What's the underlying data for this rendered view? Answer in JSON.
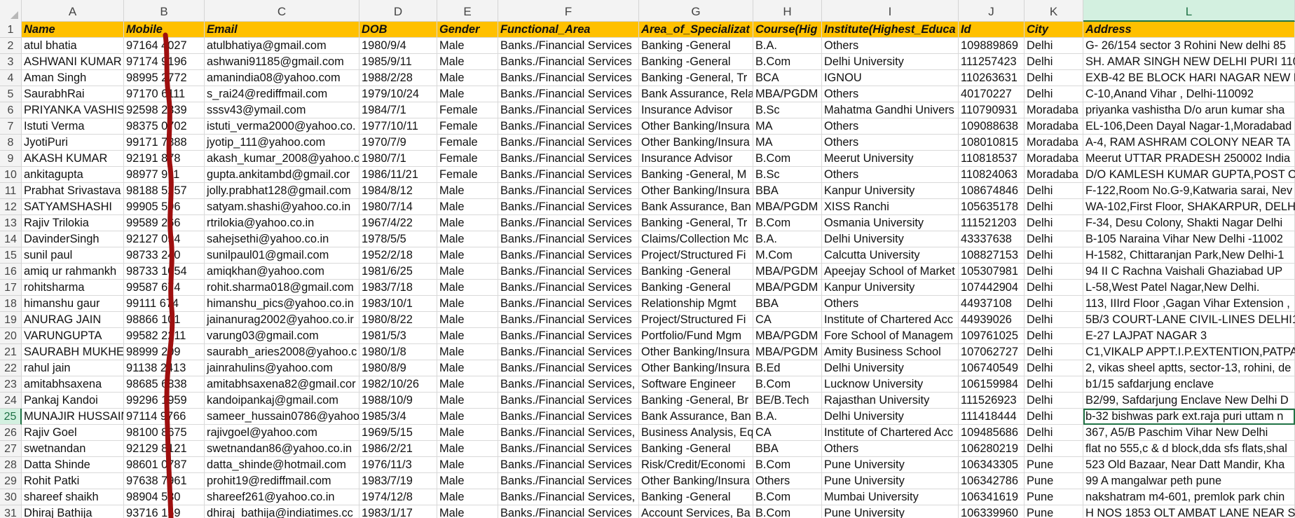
{
  "columns": [
    "A",
    "B",
    "C",
    "D",
    "E",
    "F",
    "G",
    "H",
    "I",
    "J",
    "K",
    "L"
  ],
  "selected_column": "L",
  "selected_row": "25",
  "header": [
    "Name",
    "Mobile",
    "Email",
    "DOB",
    "Gender",
    "Functional_Area",
    "Area_of_Specializat",
    "Course(Hig",
    "Institute(Highest_Educa",
    "Id",
    "City",
    "Address"
  ],
  "rows": [
    {
      "num": "2",
      "cells": [
        "atul bhatia",
        "97164 4027",
        "atulbhatiya@gmail.com",
        "1980/9/4",
        "Male",
        "Banks./Financial Services",
        "Banking -General",
        "B.A.",
        "Others",
        "109889869",
        "Delhi",
        "G- 26/154 sector 3 Rohini New delhi 85"
      ]
    },
    {
      "num": "3",
      "cells": [
        "ASHWANI KUMAR",
        "97174 9196",
        "ashwani91185@gmail.com",
        "1985/9/11",
        "Male",
        "Banks./Financial Services",
        "Banking -General",
        "B.Com",
        "Delhi University",
        "111257423",
        "Delhi",
        "SH. AMAR SINGH NEW DELHI PURI 110"
      ]
    },
    {
      "num": "4",
      "cells": [
        "Aman Singh",
        "98995 2772",
        "amanindia08@yahoo.com",
        "1988/2/28",
        "Male",
        "Banks./Financial Services",
        "Banking -General, Tr",
        "BCA",
        "IGNOU",
        "110263631",
        "Delhi",
        "EXB-42 BE BLOCK HARI NAGAR NEW D"
      ]
    },
    {
      "num": "5",
      "cells": [
        "SaurabhRai",
        "97170 6111",
        "s_rai24@rediffmail.com",
        "1979/10/24",
        "Male",
        "Banks./Financial Services",
        "Bank Assurance, Rela",
        "MBA/PGDM",
        "Others",
        "40170227",
        "Delhi",
        "C-10,Anand Vihar , Delhi-110092"
      ]
    },
    {
      "num": "6",
      "cells": [
        "PRIYANKA VASHIST",
        "92598 2339",
        "sssv43@ymail.com",
        "1984/7/1",
        "Female",
        "Banks./Financial Services",
        "Insurance Advisor",
        "B.Sc",
        "Mahatma Gandhi Univers",
        "110790931",
        "Moradaba",
        "priyanka vashistha D/o arun kumar sha"
      ]
    },
    {
      "num": "7",
      "cells": [
        "Istuti Verma",
        "98375 0702",
        "istuti_verma2000@yahoo.co.",
        "1977/10/11",
        "Female",
        "Banks./Financial Services",
        "Other Banking/Insura",
        "MA",
        "Others",
        "109088638",
        "Moradaba",
        "EL-106,Deen Dayal Nagar-1,Moradabad"
      ]
    },
    {
      "num": "8",
      "cells": [
        "JyotiPuri",
        "99171 7888",
        "jyotip_111@yahoo.com",
        "1970/7/9",
        "Female",
        "Banks./Financial Services",
        "Other Banking/Insura",
        "MA",
        "Others",
        "108010815",
        "Moradaba",
        "A-4, RAM ASHRAM COLONY NEAR TA"
      ]
    },
    {
      "num": "9",
      "cells": [
        "AKASH KUMAR",
        "92191 878",
        "akash_kumar_2008@yahoo.c",
        "1980/7/1",
        "Female",
        "Banks./Financial Services",
        "Insurance Advisor",
        "B.Com",
        "Meerut University",
        "110818537",
        "Moradaba",
        "Meerut UTTAR PRADESH 250002 India"
      ]
    },
    {
      "num": "10",
      "cells": [
        "ankitagupta",
        "98977 911",
        "gupta.ankitambd@gmail.cor",
        "1986/11/21",
        "Female",
        "Banks./Financial Services",
        "Banking -General, M",
        "B.Sc",
        "Others",
        "110824063",
        "Moradaba",
        "D/O KAMLESH KUMAR GUPTA,POST O"
      ]
    },
    {
      "num": "11",
      "cells": [
        "Prabhat Srivastava",
        "98188 5257",
        "jolly.prabhat128@gmail.com",
        "1984/8/12",
        "Male",
        "Banks./Financial Services",
        "Other Banking/Insura",
        "BBA",
        "Kanpur University",
        "108674846",
        "Delhi",
        "F-122,Room No.G-9,Katwaria sarai, Nev"
      ]
    },
    {
      "num": "12",
      "cells": [
        "SATYAMSHASHI",
        "99905 596",
        "satyam.shashi@yahoo.co.in",
        "1980/7/14",
        "Male",
        "Banks./Financial Services",
        "Bank Assurance, Ban",
        "MBA/PGDM",
        "XISS Ranchi",
        "105635178",
        "Delhi",
        "WA-102,First Floor, SHAKARPUR, DELH"
      ]
    },
    {
      "num": "13",
      "cells": [
        "Rajiv Trilokia",
        "99589 266",
        "rtrilokia@yahoo.co.in",
        "1967/4/22",
        "Male",
        "Banks./Financial Services",
        "Banking -General, Tr",
        "B.Com",
        "Osmania University",
        "111521203",
        "Delhi",
        "F-34, Desu Colony, Shakti Nagar Delhi"
      ]
    },
    {
      "num": "14",
      "cells": [
        "DavinderSingh",
        "92127 094",
        "sahejsethi@yahoo.co.in",
        "1978/5/5",
        "Male",
        "Banks./Financial Services",
        "Claims/Collection Mc",
        "B.A.",
        "Delhi University",
        "43337638",
        "Delhi",
        "B-105 Naraina Vihar New Delhi -11002"
      ]
    },
    {
      "num": "15",
      "cells": [
        "sunil paul",
        "98733 240",
        "sunilpaul01@gmail.com",
        "1952/2/18",
        "Male",
        "Banks./Financial Services",
        "Project/Structured Fi",
        "M.Com",
        "Calcutta University",
        "108827153",
        "Delhi",
        "H-1582, Chittaranjan Park,New Delhi-1"
      ]
    },
    {
      "num": "16",
      "cells": [
        "amiq ur rahmankh",
        "98733 1054",
        "amiqkhan@yahoo.com",
        "1981/6/25",
        "Male",
        "Banks./Financial Services",
        "Banking -General",
        "MBA/PGDM",
        "Apeejay School of Market",
        "105307981",
        "Delhi",
        "94 II C Rachna Vaishali Ghaziabad UP"
      ]
    },
    {
      "num": "17",
      "cells": [
        "rohitsharma",
        "99587 674",
        "rohit.sharma018@gmail.com",
        "1983/7/18",
        "Male",
        "Banks./Financial Services",
        "Banking -General",
        "MBA/PGDM",
        "Kanpur University",
        "107442904",
        "Delhi",
        "L-58,West Patel Nagar,New Delhi."
      ]
    },
    {
      "num": "18",
      "cells": [
        "himanshu gaur",
        "99111 674",
        "himanshu_pics@yahoo.co.in",
        "1983/10/1",
        "Male",
        "Banks./Financial Services",
        "Relationship Mgmt",
        "BBA",
        "Others",
        "44937108",
        "Delhi",
        "113, IIIrd Floor ,Gagan Vihar Extension ,"
      ]
    },
    {
      "num": "19",
      "cells": [
        "ANURAG JAIN",
        "98866 101",
        "jainanurag2002@yahoo.co.ir",
        "1980/8/22",
        "Male",
        "Banks./Financial Services",
        "Project/Structured Fi",
        "CA",
        "Institute of Chartered Acc",
        "44939026",
        "Delhi",
        "5B/3 COURT-LANE CIVIL-LINES DELHI1"
      ]
    },
    {
      "num": "20",
      "cells": [
        "VARUNGUPTA",
        "99582 2211",
        "varung03@gmail.com",
        "1981/5/3",
        "Male",
        "Banks./Financial Services",
        "Portfolio/Fund Mgm",
        "MBA/PGDM",
        "Fore School of Managem",
        "109761025",
        "Delhi",
        "E-27 LAJPAT NAGAR 3"
      ]
    },
    {
      "num": "21",
      "cells": [
        "SAURABH MUKHEI",
        "98999 209",
        "saurabh_aries2008@yahoo.c",
        "1980/1/8",
        "Male",
        "Banks./Financial Services",
        "Other Banking/Insura",
        "MBA/PGDM",
        "Amity Business School",
        "107062727",
        "Delhi",
        "C1,VIKALP APPT.I.P.EXTENTION,PATPAR"
      ]
    },
    {
      "num": "22",
      "cells": [
        "rahul jain",
        "91138 2413",
        "jainrahulins@yahoo.com",
        "1980/8/9",
        "Male",
        "Banks./Financial Services",
        "Other Banking/Insura",
        "B.Ed",
        "Delhi University",
        "106740549",
        "Delhi",
        "2, vikas sheel aptts, sector-13, rohini, de"
      ]
    },
    {
      "num": "23",
      "cells": [
        "amitabhsaxena",
        "98685 6838",
        "amitabhsaxena82@gmail.cor",
        "1982/10/26",
        "Male",
        "Banks./Financial Services, I",
        "Software Engineer",
        "B.Com",
        "Lucknow University",
        "106159984",
        "Delhi",
        "b1/15 safdarjung enclave"
      ]
    },
    {
      "num": "24",
      "cells": [
        "Pankaj Kandoi",
        "99296 1959",
        "kandoipankaj@gmail.com",
        "1988/10/9",
        "Male",
        "Banks./Financial Services",
        "Banking -General, Br",
        "BE/B.Tech",
        "Rajasthan University",
        "111526923",
        "Delhi",
        "B2/99, Safdarjung Enclave New Delhi D"
      ]
    },
    {
      "num": "25",
      "cells": [
        "MUNAJIR HUSSAIN",
        "97114 9766",
        "sameer_hussain0786@yahoo",
        "1985/3/4",
        "Male",
        "Banks./Financial Services",
        "Bank Assurance, Ban",
        "B.A.",
        "Delhi University",
        "111418444",
        "Delhi",
        "b-32 bishwas park ext.raja puri uttam n"
      ]
    },
    {
      "num": "26",
      "cells": [
        "Rajiv Goel",
        "98100 8675",
        "rajivgoel@yahoo.com",
        "1969/5/15",
        "Male",
        "Banks./Financial Services, 0",
        "Business Analysis, Eq",
        "CA",
        "Institute of Chartered Acc",
        "109485686",
        "Delhi",
        "367, A5/B Paschim Vihar New Delhi"
      ]
    },
    {
      "num": "27",
      "cells": [
        "swetnandan",
        "92129 8121",
        "swetnandan86@yahoo.co.in",
        "1986/2/21",
        "Male",
        "Banks./Financial Services",
        "Banking -General",
        "BBA",
        "Others",
        "106280219",
        "Delhi",
        "flat no 555,c & d block,dda sfs flats,shal"
      ]
    },
    {
      "num": "28",
      "cells": [
        "Datta Shinde",
        "98601 0787",
        "datta_shinde@hotmail.com",
        "1976/11/3",
        "Male",
        "Banks./Financial Services",
        "Risk/Credit/Economi",
        "B.Com",
        "Pune University",
        "106343305",
        "Pune",
        "523 Old Bazaar, Near Datt Mandir, Kha"
      ]
    },
    {
      "num": "29",
      "cells": [
        "Rohit Patki",
        "97638 7961",
        "prohit19@rediffmail.com",
        "1983/7/19",
        "Male",
        "Banks./Financial Services",
        "Other Banking/Insura",
        "Others",
        "Pune University",
        "106342786",
        "Pune",
        "99 A mangalwar peth pune"
      ]
    },
    {
      "num": "30",
      "cells": [
        "shareef shaikh",
        "98904 580",
        "shareef261@yahoo.co.in",
        "1974/12/8",
        "Male",
        "Banks./Financial Services, I",
        "Banking -General",
        "B.Com",
        "Mumbai University",
        "106341619",
        "Pune",
        "nakshatram m4-601, premlok park chin"
      ]
    },
    {
      "num": "31",
      "cells": [
        "Dhiraj Bathija",
        "93716 159",
        "dhiraj_bathija@indiatimes.cc",
        "1983/1/17",
        "Male",
        "Banks./Financial Services",
        "Account Services, Ba",
        "B.Com",
        "Pune University",
        "106339960",
        "Pune",
        "H NOS 1853 OLT AMBAT LANE NEAR S"
      ]
    }
  ]
}
